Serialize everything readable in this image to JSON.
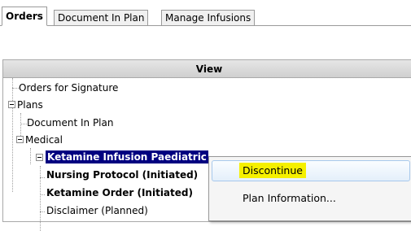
{
  "tabs": [
    {
      "label": "Orders",
      "active": true
    },
    {
      "label": "Document In Plan",
      "active": false
    },
    {
      "label": "Manage Infusions",
      "active": false
    }
  ],
  "view": {
    "header": "View",
    "tree": [
      {
        "label": "Orders for Signature"
      },
      {
        "label": "Plans",
        "expanded": true
      },
      {
        "label": "Document In Plan"
      },
      {
        "label": "Medical",
        "expanded": true
      },
      {
        "label": "Ketamine Infusion Paediatric",
        "selected": true,
        "expanded": true
      },
      {
        "label": "Nursing Protocol (Initiated)",
        "bold": true
      },
      {
        "label": "Ketamine Order (Initiated)",
        "bold": true
      },
      {
        "label": "Disclaimer (Planned)"
      }
    ]
  },
  "context_menu": {
    "items": [
      {
        "label": "Discontinue",
        "hovered": true
      },
      {
        "label": "Plan Information..."
      }
    ]
  },
  "colors": {
    "selection_bg": "#000080",
    "highlight": "#f5f000",
    "menu_hover_border": "#a8c9ec"
  }
}
